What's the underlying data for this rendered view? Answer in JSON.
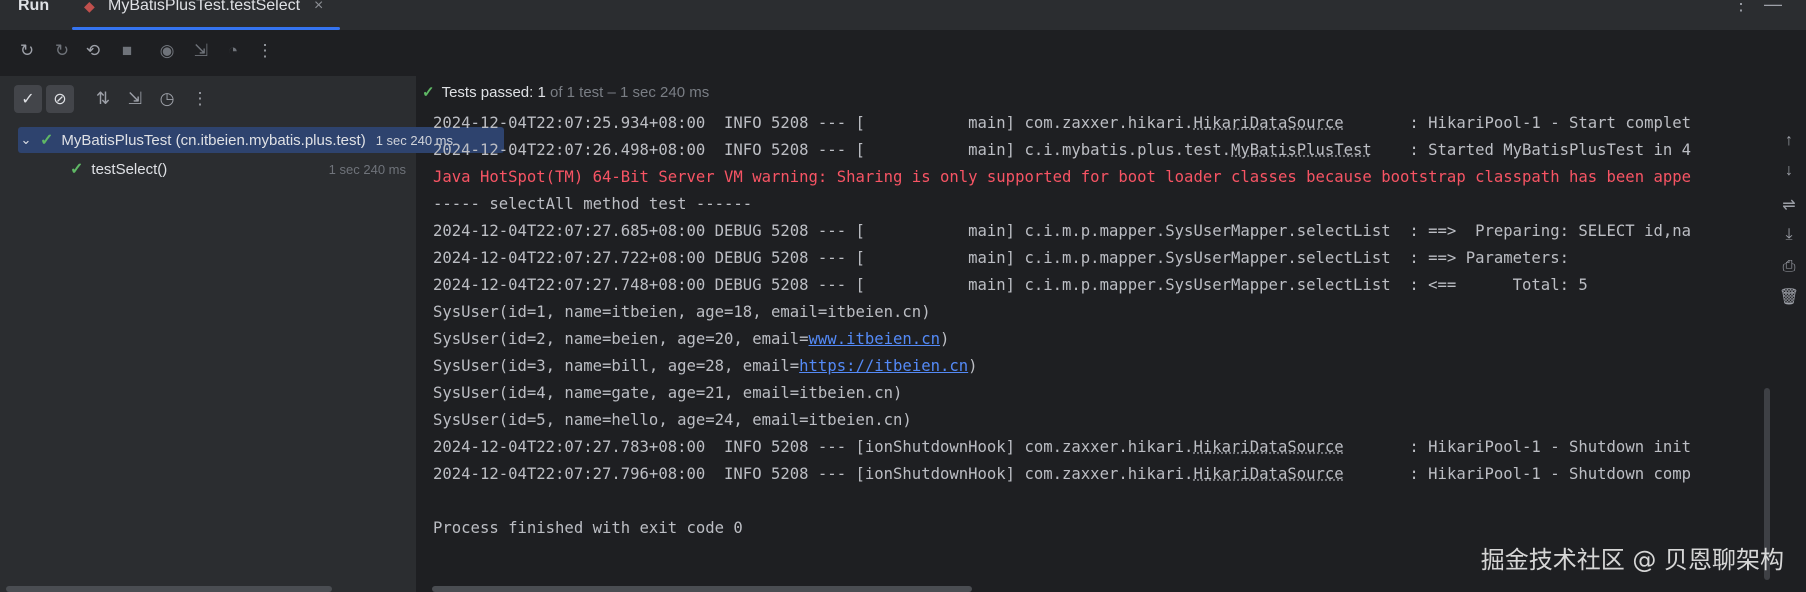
{
  "header": {
    "tool_window": "Run",
    "tab_title": "MyBatisPlusTest.testSelect",
    "tab_close": "×",
    "more_icon": "⋮",
    "minimize_icon": "—"
  },
  "tree": {
    "suite": {
      "label": "MyBatisPlusTest (cn.itbeien.mybatis.plus.test)",
      "time": "1 sec 240 ms"
    },
    "test": {
      "label": "testSelect()",
      "time": "1 sec 240 ms"
    }
  },
  "status": {
    "prefix": "Tests passed:",
    "count": "1",
    "rest": "of 1 test – 1 sec 240 ms"
  },
  "console": {
    "l1": {
      "a": "2024-12-04T22:07:25.934+08:00  INFO 5208 --- [           main] com.zaxxer.hikari.",
      "cls": "HikariDataSource",
      "b": "       : HikariPool-1 - Start complet"
    },
    "l2": {
      "a": "2024-12-04T22:07:26.498+08:00  INFO 5208 --- [           main] c.i.mybatis.plus.test.",
      "cls": "MyBatisPlusTest",
      "b": "    : Started MyBatisPlusTest in 4"
    },
    "l3": "Java HotSpot(TM) 64-Bit Server VM warning: Sharing is only supported for boot loader classes because bootstrap classpath has been appe",
    "l4": "----- selectAll method test ------",
    "l5": "2024-12-04T22:07:27.685+08:00 DEBUG 5208 --- [           main] c.i.m.p.mapper.SysUserMapper.selectList  : ==>  Preparing: SELECT id,na",
    "l6": "2024-12-04T22:07:27.722+08:00 DEBUG 5208 --- [           main] c.i.m.p.mapper.SysUserMapper.selectList  : ==> Parameters:",
    "l7": "2024-12-04T22:07:27.748+08:00 DEBUG 5208 --- [           main] c.i.m.p.mapper.SysUserMapper.selectList  : <==      Total: 5",
    "l8": "SysUser(id=1, name=itbeien, age=18, email=itbeien.cn)",
    "l9": {
      "a": "SysUser(id=2, name=beien, age=20, email=",
      "link": "www.itbeien.cn",
      "b": ")"
    },
    "l10": {
      "a": "SysUser(id=3, name=bill, age=28, email=",
      "link": "https://itbeien.cn",
      "b": ")"
    },
    "l11": "SysUser(id=4, name=gate, age=21, email=itbeien.cn)",
    "l12": "SysUser(id=5, name=hello, age=24, email=itbeien.cn)",
    "l13": {
      "a": "2024-12-04T22:07:27.783+08:00  INFO 5208 --- [ionShutdownHook] com.zaxxer.hikari.",
      "cls": "HikariDataSource",
      "b": "       : HikariPool-1 - Shutdown init"
    },
    "l14": {
      "a": "2024-12-04T22:07:27.796+08:00  INFO 5208 --- [ionShutdownHook] com.zaxxer.hikari.",
      "cls": "HikariDataSource",
      "b": "       : HikariPool-1 - Shutdown comp"
    },
    "l15": "Process finished with exit code 0"
  },
  "icons": {
    "rerun": "↻",
    "rerun_failed": "↻",
    "rerun_auto": "⟲",
    "stop": "■",
    "snapshot": "◉",
    "import": "⇲",
    "coverage": "◔",
    "more": "⋮",
    "show_passed": "✓",
    "show_ignored": "⊘",
    "sort_alpha": "⇅",
    "sort_duration": "⇲",
    "history": "◷",
    "up": "↑",
    "down": "↓",
    "wrap": "⇌",
    "scroll_end": "⤓",
    "print": "⎙",
    "trash": "🗑",
    "chevron": "⌄",
    "pass": "✓"
  },
  "watermark": "掘金技术社区 @ 贝恩聊架构",
  "colors": {
    "accent": "#3574f0",
    "pass": "#5fb865",
    "warning": "#f75464",
    "link": "#548af7",
    "selection": "#2e436e"
  }
}
